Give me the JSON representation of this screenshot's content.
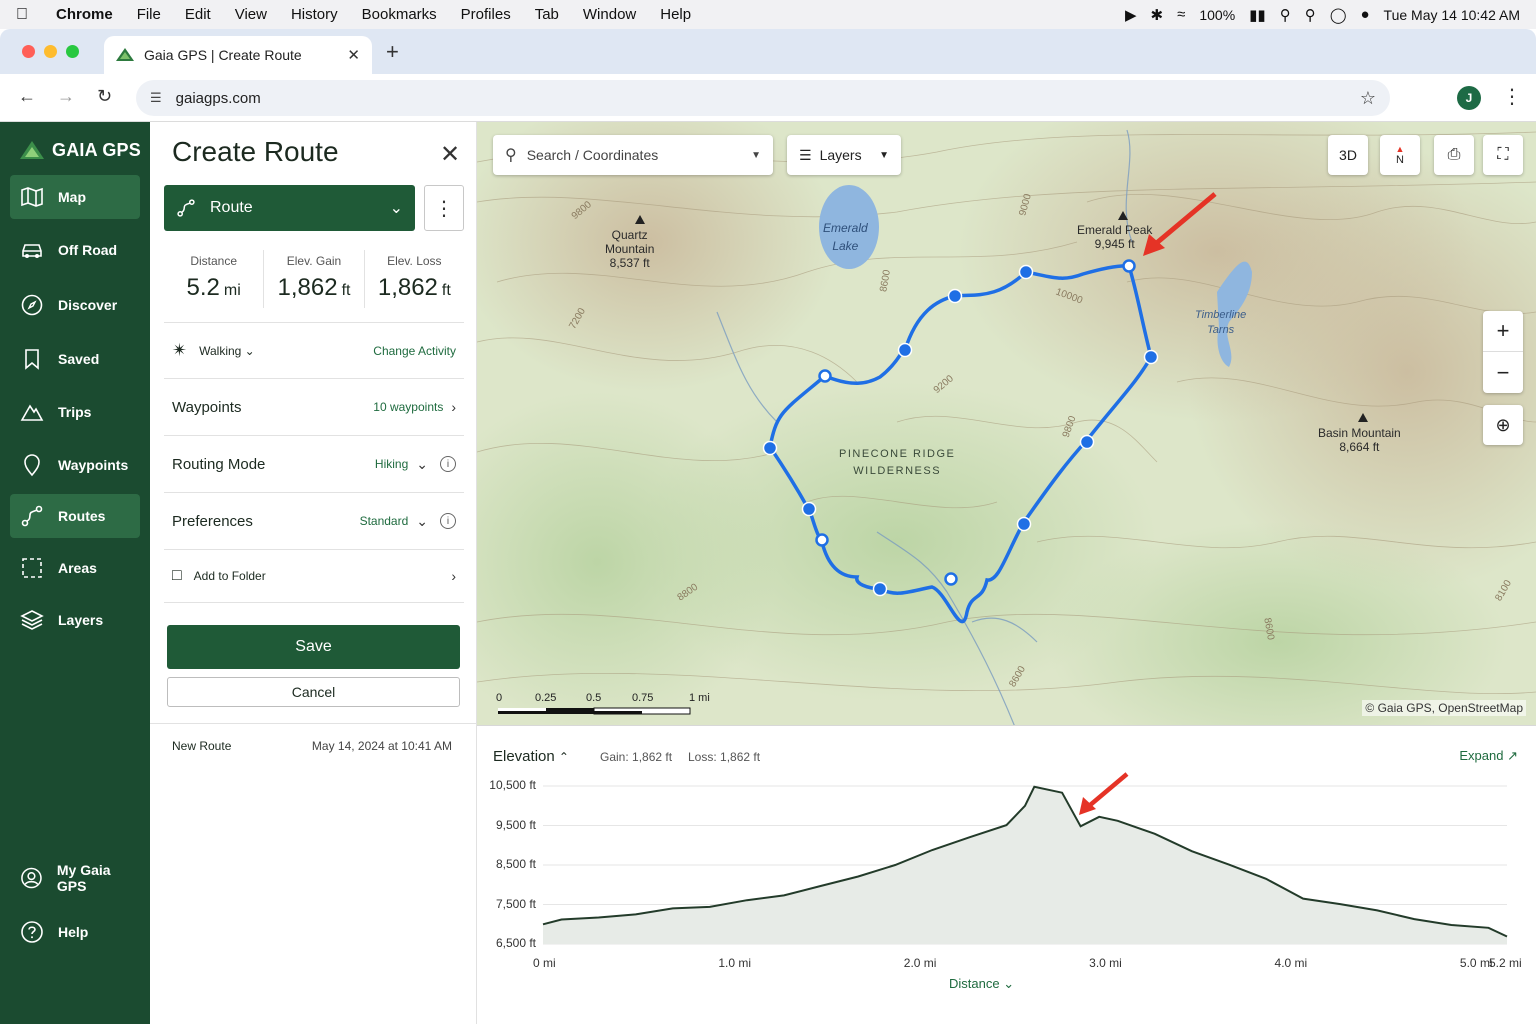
{
  "mac_menu": {
    "app": "Chrome",
    "items": [
      "File",
      "Edit",
      "View",
      "History",
      "Bookmarks",
      "Profiles",
      "Tab",
      "Window",
      "Help"
    ],
    "battery": "100%",
    "clock": "Tue May 14  10:42 AM"
  },
  "browser": {
    "tab_title": "Gaia GPS | Create Route",
    "url": "gaiagps.com",
    "profile_initial": "J"
  },
  "sidebar": {
    "brand": "GAIA GPS",
    "items": [
      {
        "label": "Map",
        "icon": "map-icon"
      },
      {
        "label": "Off Road",
        "icon": "car-icon"
      },
      {
        "label": "Discover",
        "icon": "compass-icon"
      },
      {
        "label": "Saved",
        "icon": "bookmark-icon"
      },
      {
        "label": "Trips",
        "icon": "mountain-icon"
      },
      {
        "label": "Waypoints",
        "icon": "pin-icon"
      },
      {
        "label": "Routes",
        "icon": "route-icon"
      },
      {
        "label": "Areas",
        "icon": "area-icon"
      },
      {
        "label": "Layers",
        "icon": "layers-icon"
      }
    ],
    "bottom_items": [
      {
        "label": "My Gaia GPS",
        "icon": "user-icon"
      },
      {
        "label": "Help",
        "icon": "help-icon"
      }
    ]
  },
  "panel": {
    "title": "Create Route",
    "route_type": "Route",
    "stats": [
      {
        "label": "Distance",
        "value": "5.2",
        "unit": "mi"
      },
      {
        "label": "Elev. Gain",
        "value": "1,862",
        "unit": "ft"
      },
      {
        "label": "Elev. Loss",
        "value": "1,862",
        "unit": "ft"
      }
    ],
    "activity": "Walking",
    "change_activity": "Change Activity",
    "waypoints_label": "Waypoints",
    "waypoints_value": "10 waypoints",
    "routing_label": "Routing Mode",
    "routing_value": "Hiking",
    "prefs_label": "Preferences",
    "prefs_value": "Standard",
    "folder_label": "Add to Folder",
    "save": "Save",
    "cancel": "Cancel",
    "route_name": "New Route",
    "route_date": "May 14, 2024 at 10:41 AM"
  },
  "map": {
    "search_placeholder": "Search / Coordinates",
    "layers": "Layers",
    "btn_3d": "3D",
    "north": "N",
    "peaks": [
      {
        "name": "Quartz\nMountain",
        "elev": "8,537 ft"
      },
      {
        "name": "Emerald Peak",
        "elev": "9,945 ft"
      },
      {
        "name": "Basin Mountain",
        "elev": "8,664 ft"
      }
    ],
    "lake": "Emerald\nLake",
    "tarns": "Timberline\nTarns",
    "wilderness": "PINECONE RIDGE\nWILDERNESS",
    "contours": [
      "9800",
      "9000",
      "8600",
      "10000",
      "7200",
      "9200",
      "9800",
      "8800",
      "8600",
      "8600",
      "8100"
    ],
    "scale": [
      "0",
      "0.25",
      "0.5",
      "0.75",
      "1 mi"
    ],
    "attribution": "© Gaia GPS, OpenStreetMap"
  },
  "elevation": {
    "title": "Elevation",
    "gain": "Gain: 1,862 ft",
    "loss": "Loss: 1,862 ft",
    "expand": "Expand",
    "x_axis_label": "Distance",
    "chart_data": {
      "type": "area",
      "ylabel": "",
      "xlabel": "Distance",
      "y_ticks": [
        "10,500 ft",
        "9,500 ft",
        "8,500 ft",
        "7,500 ft",
        "6,500 ft"
      ],
      "x_ticks": [
        "0 mi",
        "1.0 mi",
        "2.0 mi",
        "3.0 mi",
        "4.0 mi",
        "5.0 mi",
        "5.2 mi"
      ],
      "ylim": [
        6500,
        10500
      ],
      "xlim": [
        0,
        5.2
      ],
      "x": [
        0,
        0.1,
        0.3,
        0.5,
        0.7,
        0.9,
        1.1,
        1.3,
        1.5,
        1.7,
        1.9,
        2.1,
        2.3,
        2.5,
        2.6,
        2.65,
        2.8,
        2.9,
        3.0,
        3.1,
        3.3,
        3.5,
        3.7,
        3.9,
        4.1,
        4.3,
        4.5,
        4.7,
        4.9,
        5.1,
        5.2
      ],
      "y": [
        7000,
        7120,
        7170,
        7250,
        7400,
        7440,
        7610,
        7730,
        7970,
        8210,
        8500,
        8880,
        9200,
        9510,
        10000,
        10480,
        10330,
        9480,
        9720,
        9620,
        9290,
        8850,
        8510,
        8150,
        7650,
        7510,
        7350,
        7130,
        6980,
        6910,
        6690
      ]
    }
  }
}
